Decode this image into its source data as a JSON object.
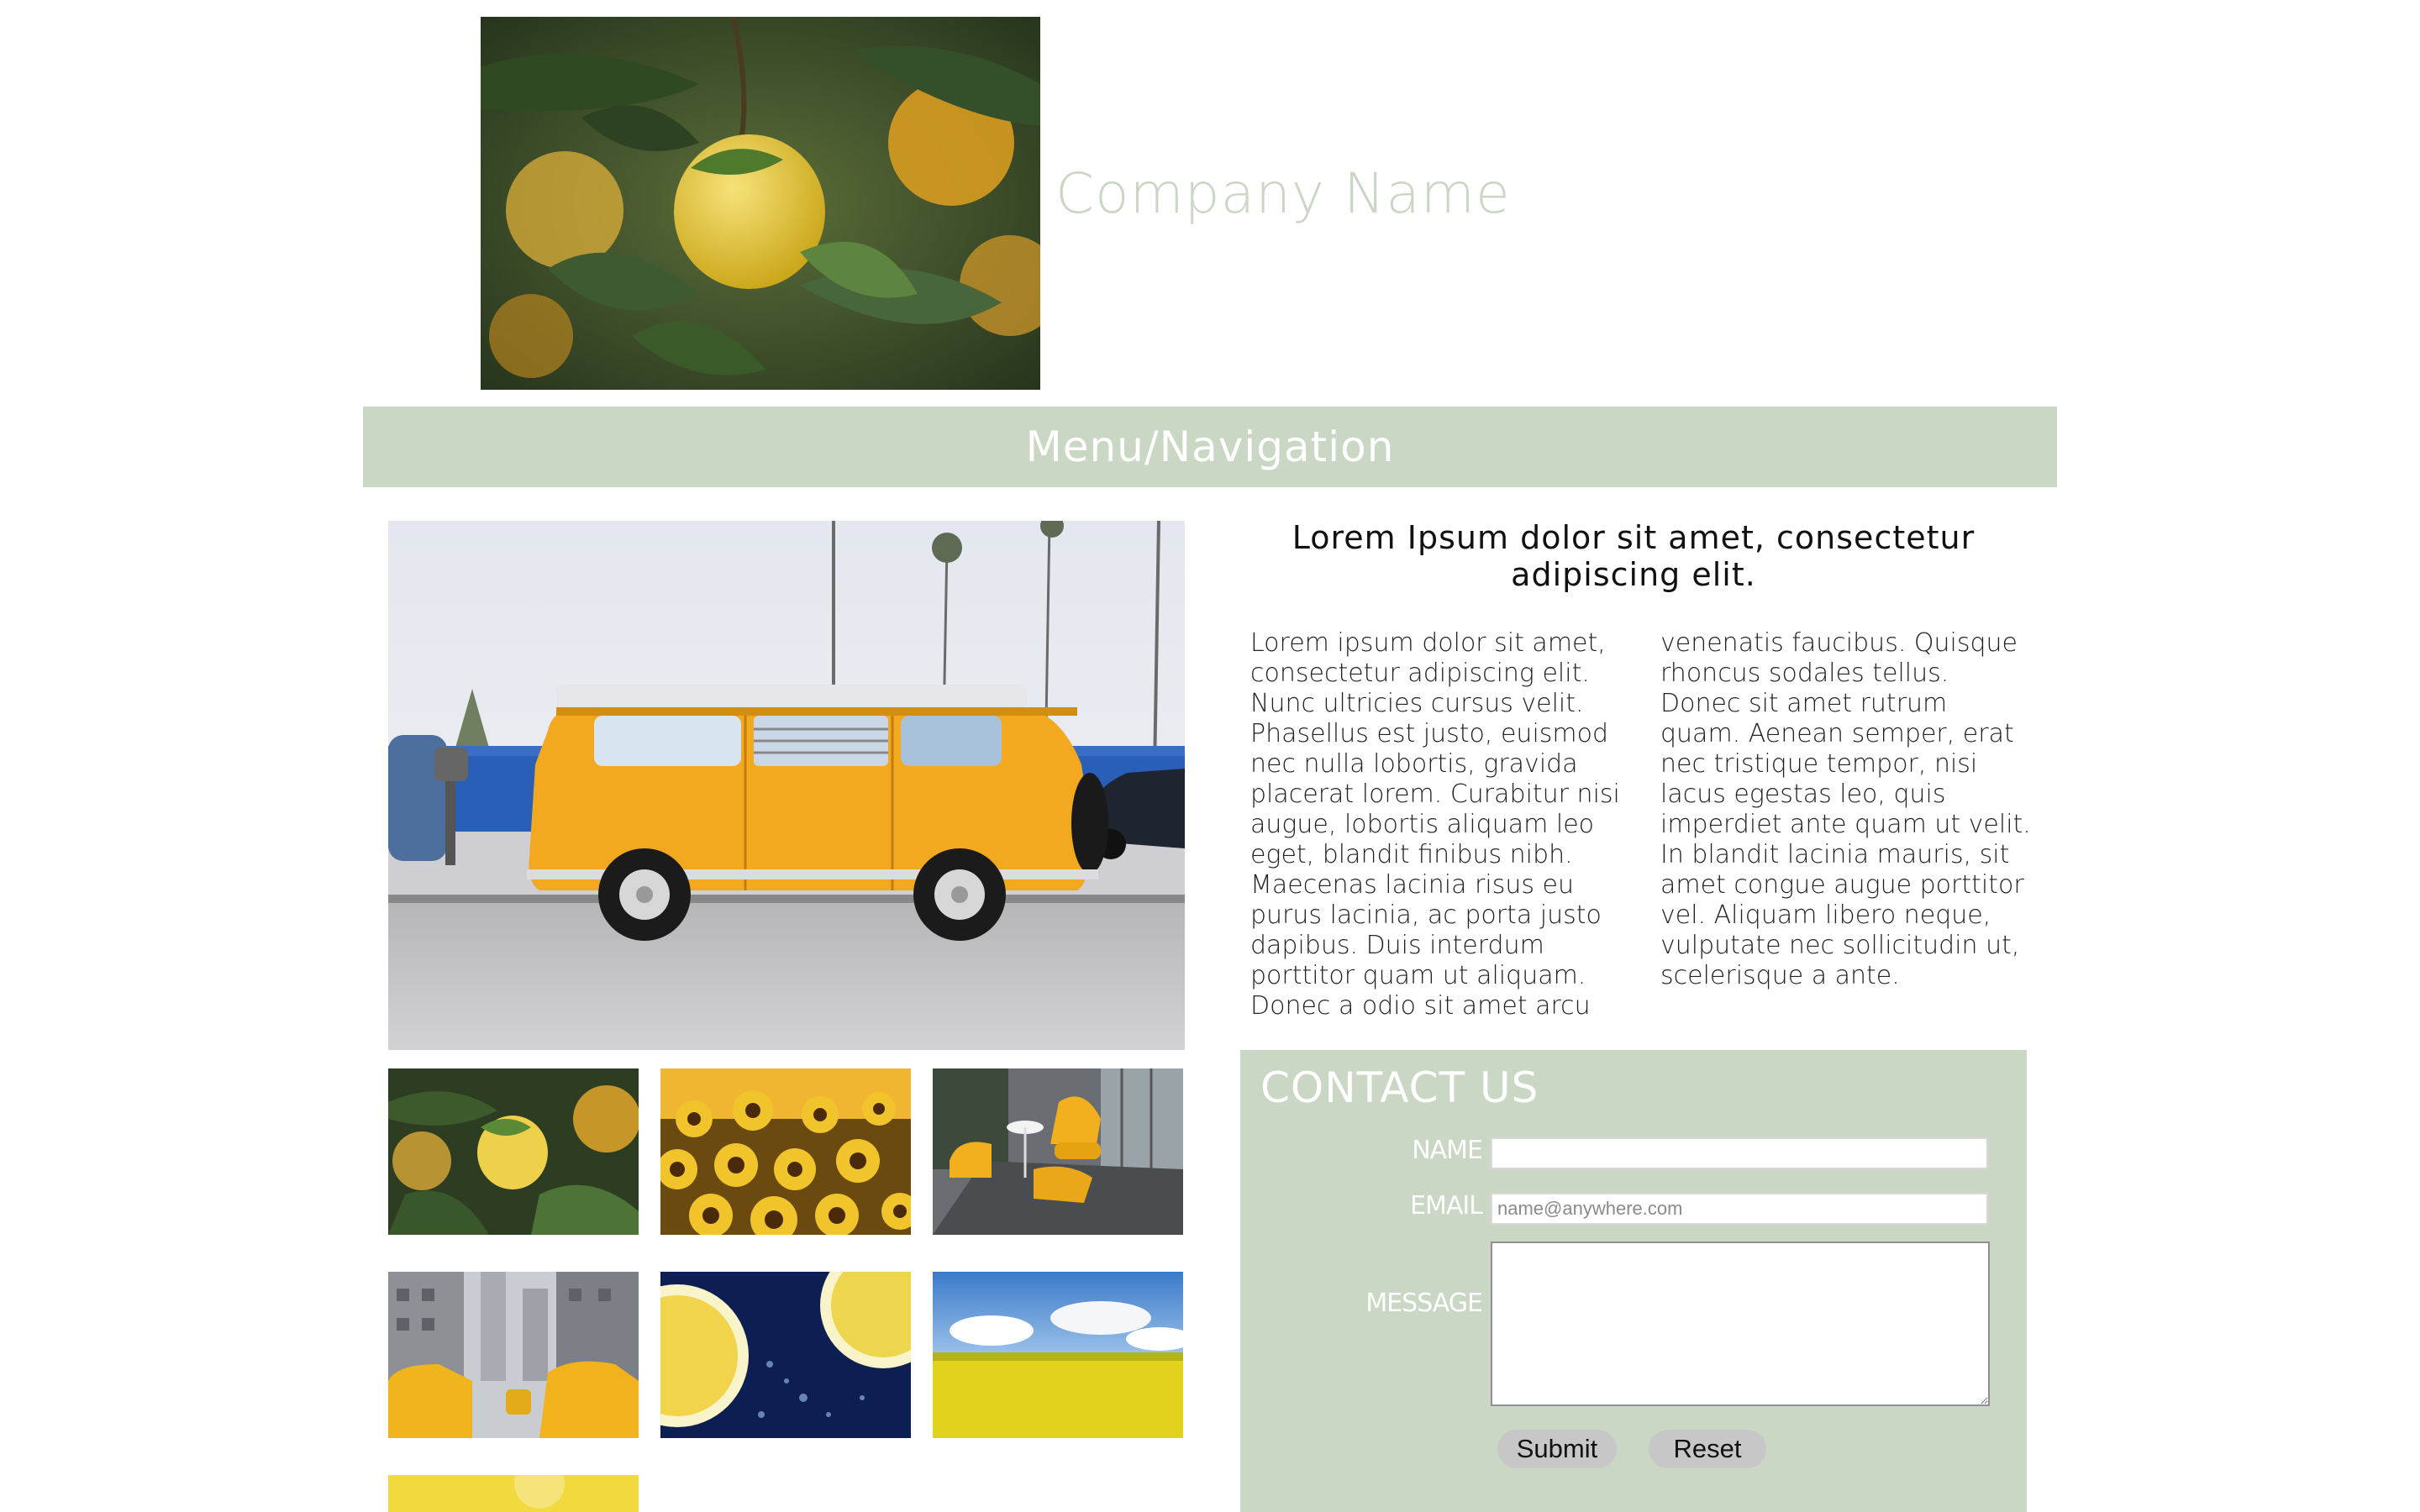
{
  "header": {
    "company_name": "Company Name"
  },
  "nav": {
    "label": "Menu/Navigation"
  },
  "article": {
    "heading": "Lorem Ipsum dolor sit amet, consectetur adipiscing elit.",
    "body": "Lorem ipsum dolor sit amet, consectetur adipiscing elit. Nunc ultricies cursus velit. Phasellus est justo, euismod nec nulla lobortis, gravida placerat lorem. Curabitur nisi augue, lobortis aliquam leo eget, blandit finibus nibh. Maecenas lacinia risus eu purus lacinia, ac porta justo dapibus. Duis interdum porttitor quam ut aliquam. Donec a odio sit amet arcu venenatis faucibus. Quisque rhoncus sodales tellus. Donec sit amet rutrum quam. Aenean semper, erat nec tristique tempor, nisi lacus egestas leo, quis imperdiet ante quam ut velit. In blandit lacinia mauris, sit amet congue augue porttitor vel. Aliquam libero neque, vulputate nec sollicitudin ut, scelerisque a ante."
  },
  "gallery": {
    "thumbnails": [
      "lemons",
      "sunflowers",
      "chairs",
      "taxis",
      "lemon-slices",
      "rapeseed-field",
      "lemon-partial"
    ]
  },
  "contact": {
    "title": "CONTACT US",
    "name_label": "NAME",
    "email_label": "EMAIL",
    "email_placeholder": "name@anywhere.com",
    "message_label": "MESSAGE",
    "submit_label": "Submit",
    "reset_label": "Reset"
  },
  "colors": {
    "accent_green": "#cad7c4",
    "company_name_color": "#cbd6c4"
  }
}
